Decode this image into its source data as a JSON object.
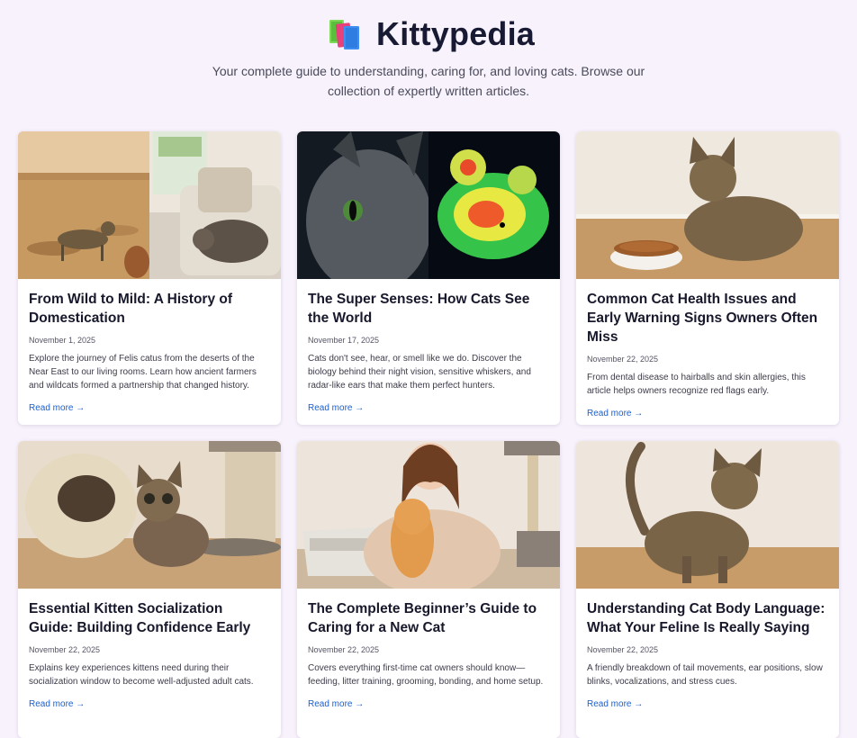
{
  "site": {
    "title": "Kittypedia",
    "logo_icon": "books-icon",
    "tagline": "Your complete guide to understanding, caring for, and loving cats. Browse our collection of expertly written articles."
  },
  "articles": [
    {
      "title": "From Wild to Mild: A History of Domestication",
      "date": "November 1, 2025",
      "excerpt": "Explore the journey of Felis catus from the deserts of the Near East to our living rooms. Learn how ancient farmers and wildcats formed a partnership that changed history.",
      "link": "Read more →"
    },
    {
      "title": "The Super Senses: How Cats See the World",
      "date": "November 17, 2025",
      "excerpt": "Cats don't see, hear, or smell like we do. Discover the biology behind their night vision, sensitive whiskers, and radar-like ears that make them perfect hunters.",
      "link": "Read more →"
    },
    {
      "title": "Common Cat Health Issues and Early Warning Signs Owners Often Miss",
      "date": "November 22, 2025",
      "excerpt": "From dental disease to hairballs and skin allergies, this article helps owners recognize red flags early.",
      "link": "Read more →"
    },
    {
      "title": "Essential Kitten Socialization Guide: Building Confidence Early",
      "date": "November 22, 2025",
      "excerpt": "Explains key experiences kittens need during their socialization window to become well-adjusted adult cats.",
      "link": "Read more →"
    },
    {
      "title": "The Complete Beginner’s Guide to Caring for a New Cat",
      "date": "November 22, 2025",
      "excerpt": "Covers everything first-time cat owners should know—feeding, litter training, grooming, bonding, and home setup.",
      "link": "Read more →"
    },
    {
      "title": "Understanding Cat Body Language: What Your Feline Is Really Saying",
      "date": "November 22, 2025",
      "excerpt": "A friendly breakdown of tail movements, ear positions, slow blinks, vocalizations, and stress cues.",
      "link": "Read more →"
    }
  ]
}
